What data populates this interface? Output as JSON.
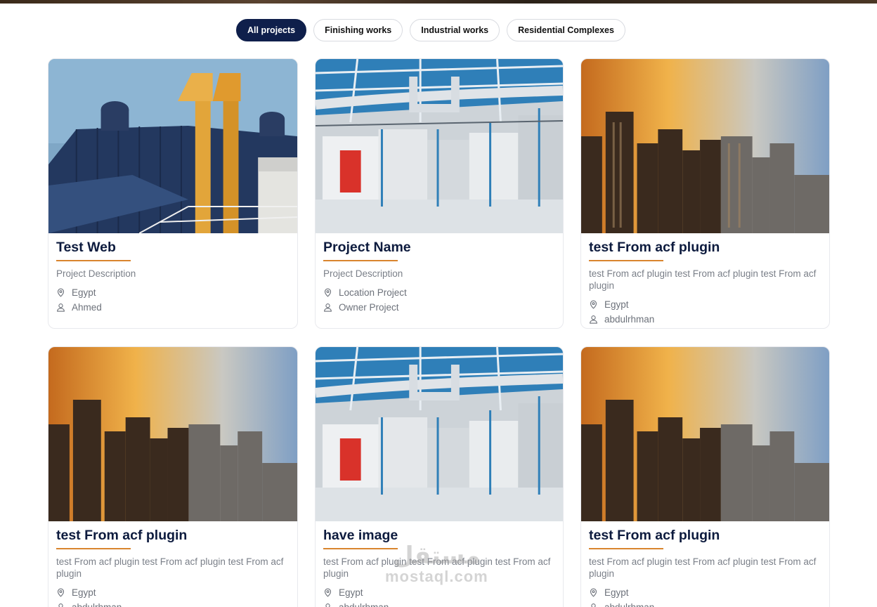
{
  "filters": [
    {
      "label": "All projects",
      "active": true
    },
    {
      "label": "Finishing works",
      "active": false
    },
    {
      "label": "Industrial works",
      "active": false
    },
    {
      "label": "Residential Complexes",
      "active": false
    }
  ],
  "projects": [
    {
      "title": "Test Web",
      "description": "Project Description",
      "location": "Egypt",
      "owner": "Ahmed",
      "image": "industrial-rooftop"
    },
    {
      "title": "Project Name",
      "description": "Project Description",
      "location": "Location Project",
      "owner": "Owner Project",
      "image": "factory-interior"
    },
    {
      "title": "test From acf plugin",
      "description": "test From acf plugin test From acf plugin test From acf plugin",
      "location": "Egypt",
      "owner": "abdulrhman",
      "image": "city-skyline"
    },
    {
      "title": "test From acf plugin",
      "description": "test From acf plugin test From acf plugin test From acf plugin",
      "location": "Egypt",
      "owner": "abdulrhman",
      "image": "city-skyline"
    },
    {
      "title": "have image",
      "description": "test From acf plugin test From acf plugin test From acf plugin",
      "location": "Egypt",
      "owner": "abdulrhman",
      "image": "factory-interior"
    },
    {
      "title": "test From acf plugin",
      "description": "test From acf plugin test From acf plugin test From acf plugin",
      "location": "Egypt",
      "owner": "abdulrhman",
      "image": "city-skyline"
    }
  ],
  "icons": {
    "location": "map-pin-icon",
    "owner": "user-icon"
  },
  "watermark": {
    "arabic": "مستقل",
    "latin": "mostaql.com"
  },
  "colors": {
    "accent": "#d9852e",
    "active_chip": "#0f1f4b",
    "title": "#0d1b3e"
  }
}
